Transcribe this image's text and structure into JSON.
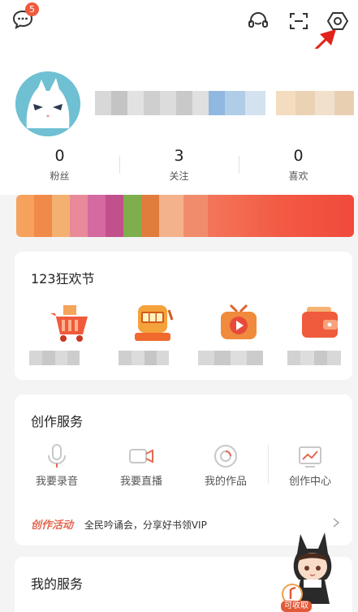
{
  "top": {
    "message_badge": "5",
    "icons": [
      "message-icon",
      "headset-icon",
      "scan-icon",
      "settings-icon"
    ]
  },
  "profile": {
    "stats": [
      {
        "value": "0",
        "label": "粉丝"
      },
      {
        "value": "3",
        "label": "关注"
      },
      {
        "value": "0",
        "label": "喜欢"
      }
    ]
  },
  "promo": {
    "title": "123狂欢节",
    "items": [
      "cart-icon",
      "slot-machine-icon",
      "video-tv-icon",
      "wallet-icon"
    ]
  },
  "creation": {
    "title": "创作服务",
    "items": [
      {
        "label": "我要录音",
        "icon": "microphone-icon"
      },
      {
        "label": "我要直播",
        "icon": "camera-icon"
      },
      {
        "label": "我的作品",
        "icon": "disc-icon"
      },
      {
        "label": "创作中心",
        "icon": "chart-icon"
      }
    ],
    "activity_tag": "创作活动",
    "activity_text": "全民吟诵会，分享好书领VIP"
  },
  "my_services": {
    "title": "我的服务"
  },
  "mascot": {
    "redeem_label": "可收取"
  },
  "colors": {
    "accent": "#f05a3c",
    "avatar_bg": "#6fc0d2"
  }
}
